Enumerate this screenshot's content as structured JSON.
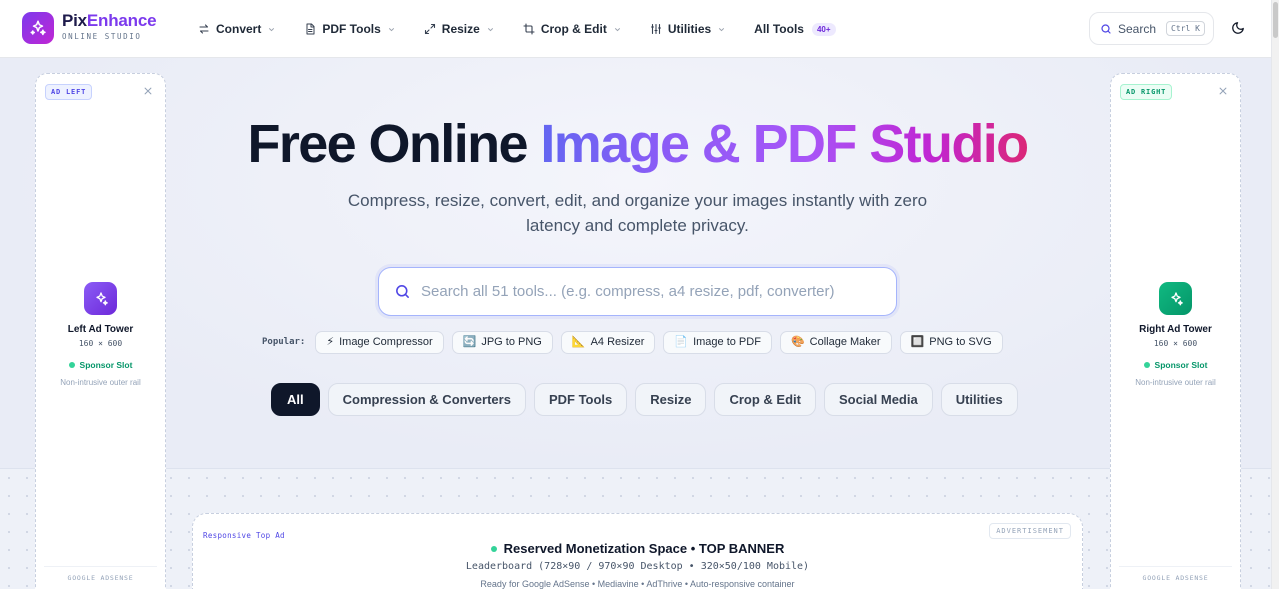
{
  "brand": {
    "name_part1": "Pix",
    "name_part2": "Enhance",
    "subtitle": "ONLINE STUDIO"
  },
  "nav": {
    "items": [
      {
        "label": "Convert",
        "icon": "convert-arrows-icon"
      },
      {
        "label": "PDF Tools",
        "icon": "document-icon"
      },
      {
        "label": "Resize",
        "icon": "resize-arrows-icon"
      },
      {
        "label": "Crop & Edit",
        "icon": "crop-icon"
      },
      {
        "label": "Utilities",
        "icon": "sliders-icon"
      }
    ],
    "all_tools": {
      "label": "All Tools",
      "badge": "40+"
    }
  },
  "header_search": {
    "label": "Search",
    "shortcut": "Ctrl K"
  },
  "left_ad": {
    "tag": "AD LEFT",
    "title": "Left Ad Tower",
    "size": "160 × 600",
    "slot": "Sponsor Slot",
    "note": "Non-intrusive outer rail",
    "footer": "GOOGLE ADSENSE"
  },
  "right_ad": {
    "tag": "AD RIGHT",
    "title": "Right Ad Tower",
    "size": "160 × 600",
    "slot": "Sponsor Slot",
    "note": "Non-intrusive outer rail",
    "footer": "GOOGLE ADSENSE"
  },
  "hero": {
    "title_dark": "Free Online ",
    "title_gradient": "Image & PDF Studio",
    "subtitle_line1": "Compress, resize, convert, edit, and organize your images instantly with zero",
    "subtitle_line2": "latency and complete privacy.",
    "search_placeholder": "Search all 51 tools... (e.g. compress, a4 resize, pdf, converter)"
  },
  "popular": {
    "label": "Popular:",
    "chips": [
      {
        "icon": "⚡",
        "label": "Image Compressor"
      },
      {
        "icon": "🔄",
        "label": "JPG to PNG"
      },
      {
        "icon": "📐",
        "label": "A4 Resizer"
      },
      {
        "icon": "📄",
        "label": "Image to PDF"
      },
      {
        "icon": "🎨",
        "label": "Collage Maker"
      },
      {
        "icon": "🔲",
        "label": "PNG to SVG"
      }
    ]
  },
  "filters": {
    "active_index": 0,
    "items": [
      "All",
      "Compression & Converters",
      "PDF Tools",
      "Resize",
      "Crop & Edit",
      "Social Media",
      "Utilities"
    ]
  },
  "top_banner": {
    "tag": "Responsive Top Ad",
    "ad_label": "ADVERTISEMENT",
    "title": "Reserved Monetization Space • TOP BANNER",
    "dims": "Leaderboard (728×90 / 970×90 Desktop • 320×50/100 Mobile)",
    "note": "Ready for Google AdSense • Mediavine • AdThrive • Auto-responsive container"
  },
  "colors": {
    "brand_purple": "#7c3aed",
    "brand_pink": "#db2777",
    "accent_indigo": "#6366f1",
    "success_green": "#059669",
    "dark": "#0f172a"
  }
}
